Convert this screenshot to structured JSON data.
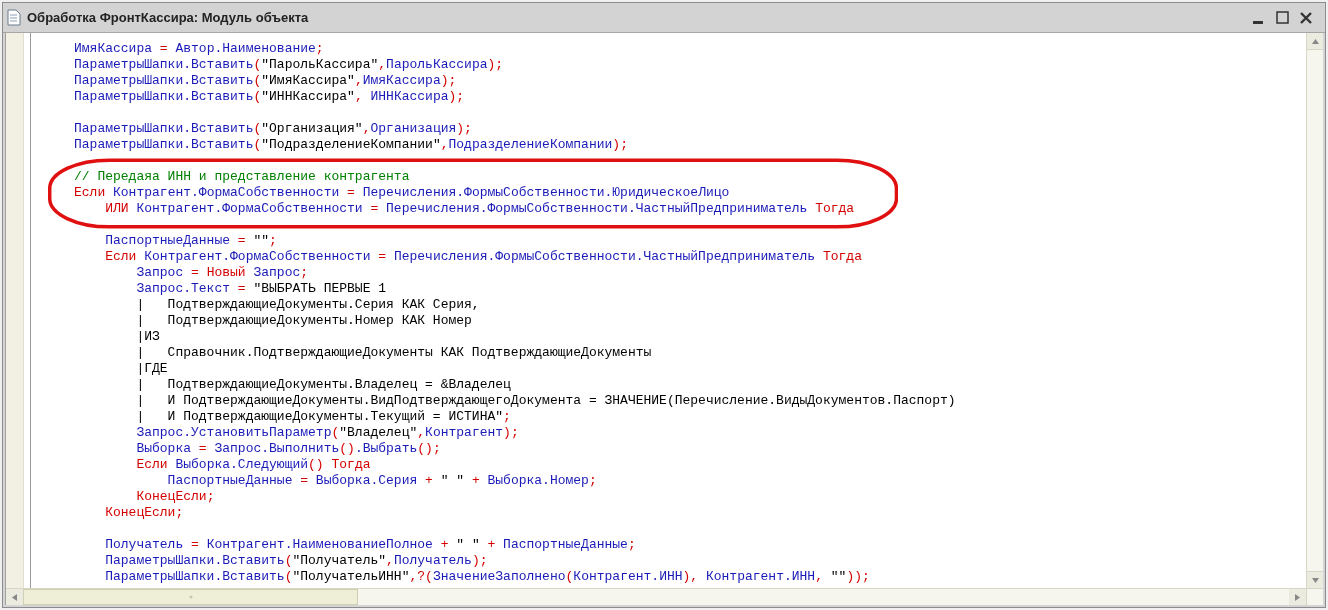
{
  "window": {
    "title": "Обработка ФронтКассира: Модуль объекта"
  },
  "code_blocks": [
    {
      "circled": false,
      "lines": [
        {
          "kind": "code",
          "segments": [
            {
              "kind": "id",
              "text": "ИмяКассира"
            },
            {
              "kind": "op",
              "text": " = "
            },
            {
              "kind": "id",
              "text": "Автор.Наименование"
            },
            {
              "kind": "op",
              "text": ";"
            }
          ]
        },
        {
          "kind": "code",
          "segments": [
            {
              "kind": "id",
              "text": "ПараметрыШапки.Вставить"
            },
            {
              "kind": "op",
              "text": "("
            },
            {
              "kind": "str",
              "text": "\"ПарольКассира\""
            },
            {
              "kind": "op",
              "text": ","
            },
            {
              "kind": "id",
              "text": "ПарольКассира"
            },
            {
              "kind": "op",
              "text": ");"
            }
          ]
        },
        {
          "kind": "code",
          "segments": [
            {
              "kind": "id",
              "text": "ПараметрыШапки.Вставить"
            },
            {
              "kind": "op",
              "text": "("
            },
            {
              "kind": "str",
              "text": "\"ИмяКассира\""
            },
            {
              "kind": "op",
              "text": ","
            },
            {
              "kind": "id",
              "text": "ИмяКассира"
            },
            {
              "kind": "op",
              "text": ");"
            }
          ]
        },
        {
          "kind": "code",
          "segments": [
            {
              "kind": "id",
              "text": "ПараметрыШапки.Вставить"
            },
            {
              "kind": "op",
              "text": "("
            },
            {
              "kind": "str",
              "text": "\"ИННКассира\""
            },
            {
              "kind": "op",
              "text": ", "
            },
            {
              "kind": "id",
              "text": "ИННКассира"
            },
            {
              "kind": "op",
              "text": ");"
            }
          ]
        },
        {
          "kind": "blank"
        },
        {
          "kind": "code",
          "segments": [
            {
              "kind": "id",
              "text": "ПараметрыШапки.Вставить"
            },
            {
              "kind": "op",
              "text": "("
            },
            {
              "kind": "str",
              "text": "\"Организация\""
            },
            {
              "kind": "op",
              "text": ","
            },
            {
              "kind": "id",
              "text": "Организация"
            },
            {
              "kind": "op",
              "text": ");"
            }
          ]
        },
        {
          "kind": "code",
          "segments": [
            {
              "kind": "id",
              "text": "ПараметрыШапки.Вставить"
            },
            {
              "kind": "op",
              "text": "("
            },
            {
              "kind": "str",
              "text": "\"ПодразделениеКомпании\""
            },
            {
              "kind": "op",
              "text": ","
            },
            {
              "kind": "id",
              "text": "ПодразделениеКомпании"
            },
            {
              "kind": "op",
              "text": ");"
            }
          ]
        },
        {
          "kind": "blank"
        }
      ]
    },
    {
      "circled": true,
      "lines": [
        {
          "kind": "code",
          "segments": [
            {
              "kind": "cmt",
              "text": "// Передаяа ИНН и представление контрагента"
            }
          ]
        },
        {
          "kind": "code",
          "segments": [
            {
              "kind": "kw",
              "text": "Если"
            },
            {
              "kind": "id",
              "text": " Контрагент.ФормаСобственности"
            },
            {
              "kind": "op",
              "text": " = "
            },
            {
              "kind": "id",
              "text": "Перечисления.ФормыСобственности.ЮридическоеЛицо"
            }
          ]
        },
        {
          "kind": "code",
          "segments": [
            {
              "kind": "kw",
              "text": "    ИЛИ"
            },
            {
              "kind": "id",
              "text": " Контрагент.ФормаСобственности"
            },
            {
              "kind": "op",
              "text": " = "
            },
            {
              "kind": "id",
              "text": "Перечисления.ФормыСобственности.ЧастныйПредприниматель"
            },
            {
              "kind": "kw",
              "text": " Тогда"
            }
          ]
        }
      ]
    },
    {
      "circled": false,
      "lines": [
        {
          "kind": "blank"
        },
        {
          "kind": "code",
          "segments": [
            {
              "kind": "id",
              "text": "    ПаспортныеДанные"
            },
            {
              "kind": "op",
              "text": " = "
            },
            {
              "kind": "str",
              "text": "\"\""
            },
            {
              "kind": "op",
              "text": ";"
            }
          ]
        },
        {
          "kind": "code",
          "segments": [
            {
              "kind": "kw",
              "text": "    Если"
            },
            {
              "kind": "id",
              "text": " Контрагент.ФормаСобственности"
            },
            {
              "kind": "op",
              "text": " = "
            },
            {
              "kind": "id",
              "text": "Перечисления.ФормыСобственности.ЧастныйПредприниматель"
            },
            {
              "kind": "kw",
              "text": " Тогда"
            }
          ]
        },
        {
          "kind": "code",
          "segments": [
            {
              "kind": "id",
              "text": "        Запрос"
            },
            {
              "kind": "op",
              "text": " = "
            },
            {
              "kind": "kw",
              "text": "Новый"
            },
            {
              "kind": "id",
              "text": " Запрос"
            },
            {
              "kind": "op",
              "text": ";"
            }
          ]
        },
        {
          "kind": "code",
          "segments": [
            {
              "kind": "id",
              "text": "        Запрос.Текст"
            },
            {
              "kind": "op",
              "text": " = "
            },
            {
              "kind": "str",
              "text": "\"ВЫБРАТЬ ПЕРВЫЕ 1"
            }
          ]
        },
        {
          "kind": "code",
          "segments": [
            {
              "kind": "str",
              "text": "        |   ПодтверждающиеДокументы.Серия КАК Серия,"
            }
          ]
        },
        {
          "kind": "code",
          "segments": [
            {
              "kind": "str",
              "text": "        |   ПодтверждающиеДокументы.Номер КАК Номер"
            }
          ]
        },
        {
          "kind": "code",
          "segments": [
            {
              "kind": "str",
              "text": "        |ИЗ"
            }
          ]
        },
        {
          "kind": "code",
          "segments": [
            {
              "kind": "str",
              "text": "        |   Справочник.ПодтверждающиеДокументы КАК ПодтверждающиеДокументы"
            }
          ]
        },
        {
          "kind": "code",
          "segments": [
            {
              "kind": "str",
              "text": "        |ГДЕ"
            }
          ]
        },
        {
          "kind": "code",
          "segments": [
            {
              "kind": "str",
              "text": "        |   ПодтверждающиеДокументы.Владелец = &Владелец"
            }
          ]
        },
        {
          "kind": "code",
          "segments": [
            {
              "kind": "str",
              "text": "        |   И ПодтверждающиеДокументы.ВидПодтверждающегоДокумента = ЗНАЧЕНИЕ(Перечисление.ВидыДокументов.Паспорт)"
            }
          ]
        },
        {
          "kind": "code",
          "segments": [
            {
              "kind": "str",
              "text": "        |   И ПодтверждающиеДокументы.Текущий = ИСТИНА\""
            },
            {
              "kind": "op",
              "text": ";"
            }
          ]
        },
        {
          "kind": "code",
          "segments": [
            {
              "kind": "id",
              "text": "        Запрос.УстановитьПараметр"
            },
            {
              "kind": "op",
              "text": "("
            },
            {
              "kind": "str",
              "text": "\"Владелец\""
            },
            {
              "kind": "op",
              "text": ","
            },
            {
              "kind": "id",
              "text": "Контрагент"
            },
            {
              "kind": "op",
              "text": ");"
            }
          ]
        },
        {
          "kind": "code",
          "segments": [
            {
              "kind": "id",
              "text": "        Выборка"
            },
            {
              "kind": "op",
              "text": " = "
            },
            {
              "kind": "id",
              "text": "Запрос.Выполнить"
            },
            {
              "kind": "op",
              "text": "()"
            },
            {
              "kind": "id",
              "text": ".Выбрать"
            },
            {
              "kind": "op",
              "text": "();"
            }
          ]
        },
        {
          "kind": "code",
          "segments": [
            {
              "kind": "kw",
              "text": "        Если"
            },
            {
              "kind": "id",
              "text": " Выборка.Следующий"
            },
            {
              "kind": "op",
              "text": "()"
            },
            {
              "kind": "kw",
              "text": " Тогда"
            }
          ]
        },
        {
          "kind": "code",
          "segments": [
            {
              "kind": "id",
              "text": "            ПаспортныеДанные"
            },
            {
              "kind": "op",
              "text": " = "
            },
            {
              "kind": "id",
              "text": "Выборка.Серия"
            },
            {
              "kind": "op",
              "text": " + "
            },
            {
              "kind": "str",
              "text": "\" \""
            },
            {
              "kind": "op",
              "text": " + "
            },
            {
              "kind": "id",
              "text": "Выборка.Номер"
            },
            {
              "kind": "op",
              "text": ";"
            }
          ]
        },
        {
          "kind": "code",
          "segments": [
            {
              "kind": "kw",
              "text": "        КонецЕсли"
            },
            {
              "kind": "op",
              "text": ";"
            }
          ]
        },
        {
          "kind": "code",
          "segments": [
            {
              "kind": "kw",
              "text": "    КонецЕсли"
            },
            {
              "kind": "op",
              "text": ";"
            }
          ]
        },
        {
          "kind": "blank"
        },
        {
          "kind": "code",
          "segments": [
            {
              "kind": "id",
              "text": "    Получатель"
            },
            {
              "kind": "op",
              "text": " = "
            },
            {
              "kind": "id",
              "text": "Контрагент.НаименованиеПолное"
            },
            {
              "kind": "op",
              "text": " + "
            },
            {
              "kind": "str",
              "text": "\" \""
            },
            {
              "kind": "op",
              "text": " + "
            },
            {
              "kind": "id",
              "text": "ПаспортныеДанные"
            },
            {
              "kind": "op",
              "text": ";"
            }
          ]
        },
        {
          "kind": "code",
          "segments": [
            {
              "kind": "id",
              "text": "    ПараметрыШапки.Вставить"
            },
            {
              "kind": "op",
              "text": "("
            },
            {
              "kind": "str",
              "text": "\"Получатель\""
            },
            {
              "kind": "op",
              "text": ","
            },
            {
              "kind": "id",
              "text": "Получатель"
            },
            {
              "kind": "op",
              "text": ");"
            }
          ]
        },
        {
          "kind": "code",
          "segments": [
            {
              "kind": "id",
              "text": "    ПараметрыШапки.Вставить"
            },
            {
              "kind": "op",
              "text": "("
            },
            {
              "kind": "str",
              "text": "\"ПолучательИНН\""
            },
            {
              "kind": "op",
              "text": ",?("
            },
            {
              "kind": "id",
              "text": "ЗначениеЗаполнено"
            },
            {
              "kind": "op",
              "text": "("
            },
            {
              "kind": "id",
              "text": "Контрагент.ИНН"
            },
            {
              "kind": "op",
              "text": "), "
            },
            {
              "kind": "id",
              "text": "Контрагент.ИНН"
            },
            {
              "kind": "op",
              "text": ", "
            },
            {
              "kind": "str",
              "text": "\"\""
            },
            {
              "kind": "op",
              "text": "));"
            }
          ]
        }
      ]
    }
  ]
}
